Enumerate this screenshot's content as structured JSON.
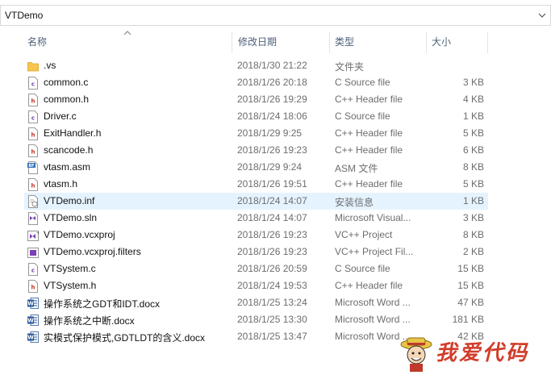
{
  "address": {
    "path": "VTDemo"
  },
  "columns": {
    "name": "名称",
    "modified": "修改日期",
    "type": "类型",
    "size": "大小"
  },
  "files": [
    {
      "name": ".vs",
      "modified": "2018/1/30 21:22",
      "type": "文件夹",
      "size": "",
      "icon": "folder-icon"
    },
    {
      "name": "common.c",
      "modified": "2018/1/26 20:18",
      "type": "C Source file",
      "size": "3 KB",
      "icon": "c-source-file-icon"
    },
    {
      "name": "common.h",
      "modified": "2018/1/26 19:29",
      "type": "C++ Header file",
      "size": "4 KB",
      "icon": "header-file-icon"
    },
    {
      "name": "Driver.c",
      "modified": "2018/1/24 18:06",
      "type": "C Source file",
      "size": "1 KB",
      "icon": "c-source-file-icon"
    },
    {
      "name": "ExitHandler.h",
      "modified": "2018/1/29 9:25",
      "type": "C++ Header file",
      "size": "5 KB",
      "icon": "header-file-icon"
    },
    {
      "name": "scancode.h",
      "modified": "2018/1/26 19:23",
      "type": "C++ Header file",
      "size": "6 KB",
      "icon": "header-file-icon"
    },
    {
      "name": "vtasm.asm",
      "modified": "2018/1/29 9:24",
      "type": "ASM 文件",
      "size": "8 KB",
      "icon": "asm-file-icon"
    },
    {
      "name": "vtasm.h",
      "modified": "2018/1/26 19:51",
      "type": "C++ Header file",
      "size": "5 KB",
      "icon": "header-file-icon"
    },
    {
      "name": "VTDemo.inf",
      "modified": "2018/1/24 14:07",
      "type": "安装信息",
      "size": "1 KB",
      "icon": "inf-file-icon",
      "selected": true
    },
    {
      "name": "VTDemo.sln",
      "modified": "2018/1/24 14:07",
      "type": "Microsoft Visual...",
      "size": "3 KB",
      "icon": "solution-file-icon"
    },
    {
      "name": "VTDemo.vcxproj",
      "modified": "2018/1/26 19:23",
      "type": "VC++ Project",
      "size": "8 KB",
      "icon": "vcxproj-file-icon"
    },
    {
      "name": "VTDemo.vcxproj.filters",
      "modified": "2018/1/26 19:23",
      "type": "VC++ Project Fil...",
      "size": "2 KB",
      "icon": "filters-file-icon"
    },
    {
      "name": "VTSystem.c",
      "modified": "2018/1/26 20:59",
      "type": "C Source file",
      "size": "15 KB",
      "icon": "c-source-file-icon"
    },
    {
      "name": "VTSystem.h",
      "modified": "2018/1/24 19:53",
      "type": "C++ Header file",
      "size": "15 KB",
      "icon": "header-file-icon"
    },
    {
      "name": "操作系统之GDT和IDT.docx",
      "modified": "2018/1/25 13:24",
      "type": "Microsoft Word ...",
      "size": "47 KB",
      "icon": "word-doc-icon"
    },
    {
      "name": "操作系统之中断.docx",
      "modified": "2018/1/25 13:30",
      "type": "Microsoft Word ...",
      "size": "181 KB",
      "icon": "word-doc-icon"
    },
    {
      "name": "实模式保护模式,GDTLDT的含义.docx",
      "modified": "2018/1/25 13:47",
      "type": "Microsoft Word ...",
      "size": "42 KB",
      "icon": "word-doc-icon"
    }
  ],
  "watermark": {
    "text": "我爱代码"
  },
  "colors": {
    "selection": "#e5f3ff",
    "header_text": "#4c607a",
    "folder": "#f7c64a",
    "word": "#2b579a",
    "watermark": "#d23c2a"
  }
}
